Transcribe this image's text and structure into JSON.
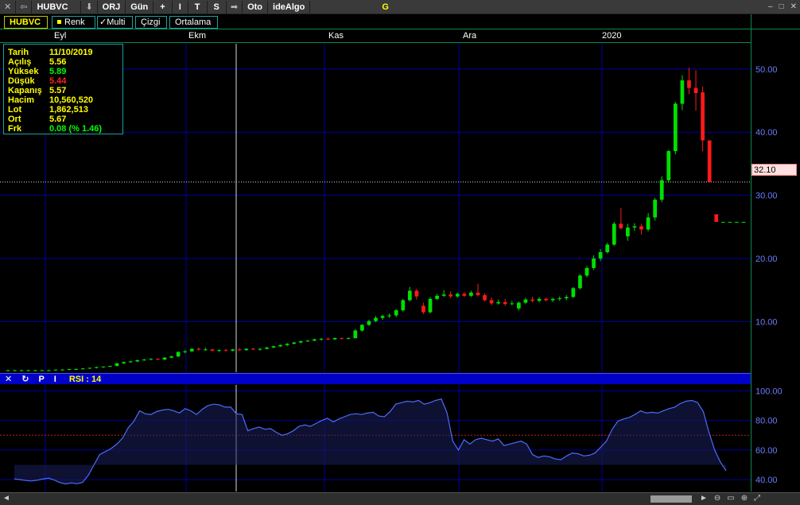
{
  "toolbar": {
    "symbol": "HUBVC",
    "items": [
      "ORJ",
      "Gün",
      "+",
      "I",
      "T",
      "S",
      "Oto",
      "ideAlgo"
    ],
    "status_letter": "G"
  },
  "buttons": {
    "symbol": "HUBVC",
    "renk": "Renk",
    "multi": "✓Multi",
    "cizgi": "Çizgi",
    "ortalama": "Ortalama"
  },
  "months": [
    "Eyl",
    "Ekm",
    "Kas",
    "Ara",
    "2020"
  ],
  "info": {
    "rows": [
      {
        "k": "Tarih",
        "v": "11/10/2019",
        "tone": "neutral"
      },
      {
        "k": "Açılış",
        "v": "5.56",
        "tone": "neutral"
      },
      {
        "k": "Yüksek",
        "v": "5.89",
        "tone": "up"
      },
      {
        "k": "Düşük",
        "v": "5.44",
        "tone": "dn"
      },
      {
        "k": "Kapanış",
        "v": "5.57",
        "tone": "neutral"
      },
      {
        "k": "Hacim",
        "v": "10,560,520",
        "tone": "neutral"
      },
      {
        "k": "Lot",
        "v": "1,862,513",
        "tone": "neutral"
      },
      {
        "k": "Ort",
        "v": "5.67",
        "tone": "neutral"
      },
      {
        "k": "Frk",
        "v": "0.08 (% 1.46)",
        "tone": "up"
      }
    ]
  },
  "last_price": "32.10",
  "rsi": {
    "icons": [
      "✕",
      "↻",
      "P",
      "I"
    ],
    "label": "RSI : 14"
  },
  "colors": {
    "up": "#00e000",
    "down": "#ff1a1a",
    "rsi_line": "#4a6cff",
    "grid": "#0000a0",
    "axis_text": "#6a7dff"
  },
  "chart_data": {
    "type": "candlestick",
    "price_axis": {
      "ticks": [
        10,
        20,
        30,
        40,
        50
      ],
      "labels": [
        "10.00",
        "20.00",
        "30.00",
        "40.00",
        "50.00"
      ],
      "ylim": [
        2,
        54
      ]
    },
    "rsi_axis": {
      "ticks": [
        40,
        60,
        80,
        100
      ],
      "labels": [
        "40.00",
        "60.00",
        "80.00",
        "100.00"
      ],
      "ylim": [
        32,
        104
      ],
      "reference": 70
    },
    "last_close": 32.1,
    "candles": [
      [
        2.3,
        2.4,
        2.2,
        2.3
      ],
      [
        2.3,
        2.4,
        2.2,
        2.3
      ],
      [
        2.3,
        2.4,
        2.2,
        2.3
      ],
      [
        2.3,
        2.4,
        2.2,
        2.3
      ],
      [
        2.3,
        2.4,
        2.2,
        2.3
      ],
      [
        2.3,
        2.4,
        2.2,
        2.3
      ],
      [
        2.3,
        2.4,
        2.2,
        2.3
      ],
      [
        2.3,
        2.4,
        2.2,
        2.4
      ],
      [
        2.4,
        2.5,
        2.3,
        2.4
      ],
      [
        2.4,
        2.5,
        2.3,
        2.5
      ],
      [
        2.5,
        2.6,
        2.4,
        2.5
      ],
      [
        2.5,
        2.6,
        2.4,
        2.6
      ],
      [
        2.6,
        2.7,
        2.5,
        2.7
      ],
      [
        2.7,
        2.9,
        2.6,
        2.8
      ],
      [
        2.8,
        2.9,
        2.7,
        2.9
      ],
      [
        2.9,
        3.0,
        2.8,
        3.0
      ],
      [
        3.0,
        3.5,
        2.9,
        3.4
      ],
      [
        3.4,
        3.7,
        3.3,
        3.6
      ],
      [
        3.6,
        3.8,
        3.5,
        3.7
      ],
      [
        3.7,
        4.0,
        3.6,
        3.9
      ],
      [
        3.9,
        4.1,
        3.8,
        4.0
      ],
      [
        4.0,
        4.2,
        3.9,
        4.1
      ],
      [
        4.1,
        4.2,
        3.9,
        4.0
      ],
      [
        4.0,
        4.4,
        3.9,
        4.3
      ],
      [
        4.3,
        4.6,
        4.2,
        4.5
      ],
      [
        4.5,
        5.3,
        4.4,
        5.2
      ],
      [
        5.2,
        5.5,
        5.0,
        5.3
      ],
      [
        5.3,
        5.8,
        5.2,
        5.7
      ],
      [
        5.7,
        5.9,
        5.4,
        5.6
      ],
      [
        5.6,
        5.9,
        5.4,
        5.6
      ],
      [
        5.6,
        5.7,
        5.3,
        5.4
      ],
      [
        5.4,
        5.6,
        5.2,
        5.5
      ],
      [
        5.5,
        5.7,
        5.3,
        5.4
      ],
      [
        5.4,
        5.7,
        5.3,
        5.6
      ],
      [
        5.6,
        5.8,
        5.4,
        5.5
      ],
      [
        5.5,
        5.8,
        5.4,
        5.7
      ],
      [
        5.7,
        5.9,
        5.5,
        5.6
      ],
      [
        5.6,
        5.8,
        5.4,
        5.7
      ],
      [
        5.7,
        6.0,
        5.6,
        5.9
      ],
      [
        5.9,
        6.2,
        5.8,
        6.1
      ],
      [
        6.1,
        6.4,
        6.0,
        6.3
      ],
      [
        6.3,
        6.6,
        6.1,
        6.5
      ],
      [
        6.5,
        6.8,
        6.4,
        6.7
      ],
      [
        6.7,
        7.0,
        6.6,
        6.9
      ],
      [
        6.9,
        7.1,
        6.8,
        7.0
      ],
      [
        7.0,
        7.3,
        6.9,
        7.2
      ],
      [
        7.2,
        7.4,
        7.0,
        7.3
      ],
      [
        7.3,
        7.5,
        7.1,
        7.2
      ],
      [
        7.2,
        7.5,
        7.1,
        7.4
      ],
      [
        7.4,
        7.5,
        7.2,
        7.3
      ],
      [
        7.3,
        7.5,
        7.2,
        7.4
      ],
      [
        7.4,
        8.8,
        7.3,
        8.6
      ],
      [
        8.6,
        9.6,
        8.4,
        9.5
      ],
      [
        9.5,
        10.3,
        9.3,
        10.1
      ],
      [
        10.1,
        10.9,
        9.9,
        10.6
      ],
      [
        10.6,
        11.1,
        10.3,
        10.9
      ],
      [
        10.9,
        11.3,
        10.6,
        11.0
      ],
      [
        11.0,
        12.0,
        10.7,
        11.8
      ],
      [
        11.8,
        13.6,
        11.6,
        13.4
      ],
      [
        13.4,
        15.5,
        13.2,
        14.9
      ],
      [
        14.9,
        15.2,
        13.5,
        14.0
      ],
      [
        12.5,
        13.0,
        11.2,
        11.5
      ],
      [
        11.5,
        13.9,
        11.3,
        13.6
      ],
      [
        13.6,
        14.4,
        13.4,
        14.1
      ],
      [
        14.1,
        15.0,
        13.9,
        14.3
      ],
      [
        14.3,
        14.8,
        13.7,
        14.0
      ],
      [
        14.0,
        14.6,
        13.8,
        14.4
      ],
      [
        14.4,
        14.7,
        13.9,
        14.1
      ],
      [
        14.1,
        14.9,
        13.9,
        14.6
      ],
      [
        14.6,
        16.0,
        14.0,
        14.2
      ],
      [
        14.2,
        14.5,
        13.2,
        13.4
      ],
      [
        13.4,
        13.8,
        12.6,
        12.9
      ],
      [
        12.9,
        13.5,
        12.7,
        13.1
      ],
      [
        13.1,
        13.6,
        12.5,
        12.8
      ],
      [
        12.8,
        13.3,
        12.6,
        12.9
      ],
      [
        12.1,
        13.2,
        11.8,
        13.0
      ],
      [
        13.0,
        13.8,
        12.8,
        13.5
      ],
      [
        13.5,
        13.9,
        13.1,
        13.3
      ],
      [
        13.3,
        13.9,
        13.1,
        13.6
      ],
      [
        13.6,
        13.8,
        13.2,
        13.4
      ],
      [
        13.4,
        13.8,
        13.1,
        13.6
      ],
      [
        13.6,
        14.0,
        13.3,
        13.7
      ],
      [
        13.7,
        14.2,
        13.4,
        13.9
      ],
      [
        13.9,
        15.5,
        13.8,
        15.3
      ],
      [
        15.3,
        17.5,
        15.1,
        17.3
      ],
      [
        17.3,
        18.8,
        17.0,
        18.5
      ],
      [
        18.5,
        20.5,
        18.2,
        20.0
      ],
      [
        20.0,
        21.5,
        19.6,
        21.0
      ],
      [
        21.0,
        22.5,
        20.8,
        22.2
      ],
      [
        22.2,
        25.8,
        22.0,
        25.5
      ],
      [
        25.5,
        28.0,
        24.6,
        24.8
      ],
      [
        23.5,
        25.5,
        22.8,
        24.9
      ],
      [
        24.9,
        25.6,
        24.4,
        25.1
      ],
      [
        25.1,
        25.5,
        23.8,
        24.6
      ],
      [
        24.6,
        27.2,
        24.3,
        26.5
      ],
      [
        26.5,
        29.6,
        26.0,
        29.3
      ],
      [
        29.3,
        33.0,
        28.9,
        32.4
      ],
      [
        32.4,
        37.2,
        32.0,
        37.0
      ],
      [
        37.0,
        44.8,
        36.5,
        44.5
      ],
      [
        44.5,
        49.0,
        43.5,
        48.2
      ],
      [
        48.2,
        50.2,
        46.0,
        47.0
      ],
      [
        47.0,
        49.8,
        43.4,
        46.2
      ],
      [
        46.3,
        47.2,
        37.0,
        38.7
      ],
      [
        38.7,
        38.7,
        32.1,
        32.1
      ],
      [
        27.0,
        27.0,
        25.8,
        25.8
      ],
      [
        25.8,
        25.8,
        25.8,
        25.8
      ],
      [
        25.8,
        25.8,
        25.8,
        25.8
      ],
      [
        25.8,
        25.8,
        25.8,
        25.8
      ],
      [
        25.8,
        25.8,
        25.8,
        25.8
      ]
    ],
    "rsi": [
      40.5,
      40.0,
      39.4,
      39.1,
      39.6,
      40.4,
      41.0,
      39.8,
      38.0,
      37.1,
      37.8,
      37.2,
      38.2,
      43.0,
      50.0,
      57.0,
      59.0,
      61.0,
      64.0,
      68.0,
      75.0,
      79.5,
      86.5,
      84.5,
      84.0,
      86.0,
      87.0,
      87.5,
      86.5,
      85.0,
      88.0,
      86.5,
      84.0,
      87.5,
      90.0,
      91.0,
      90.5,
      89.0,
      89.0,
      84.5,
      84.0,
      73.0,
      74.5,
      75.5,
      74.0,
      74.5,
      72.0,
      70.0,
      71.0,
      73.0,
      76.0,
      77.0,
      76.0,
      78.0,
      80.0,
      81.5,
      79.0,
      81.0,
      82.5,
      84.0,
      84.5,
      84.0,
      85.0,
      85.5,
      83.0,
      82.5,
      86.0,
      91.0,
      92.0,
      93.0,
      92.5,
      93.5,
      91.0,
      92.0,
      93.5,
      94.5,
      85.0,
      66.0,
      60.0,
      67.0,
      64.0,
      67.0,
      68.0,
      67.0,
      66.0,
      67.5,
      63.0,
      64.0,
      65.0,
      66.0,
      64.0,
      57.0,
      55.0,
      56.0,
      55.5,
      54.0,
      53.5,
      56.0,
      58.0,
      57.5,
      56.0,
      56.5,
      58.0,
      62.0,
      66.0,
      74.0,
      79.5,
      81.0,
      82.0,
      84.0,
      86.5,
      85.0,
      85.5,
      85.0,
      86.5,
      88.0,
      89.0,
      91.5,
      93.0,
      93.5,
      92.0,
      86.0,
      72.0,
      60.0,
      52.0,
      46.0
    ]
  }
}
